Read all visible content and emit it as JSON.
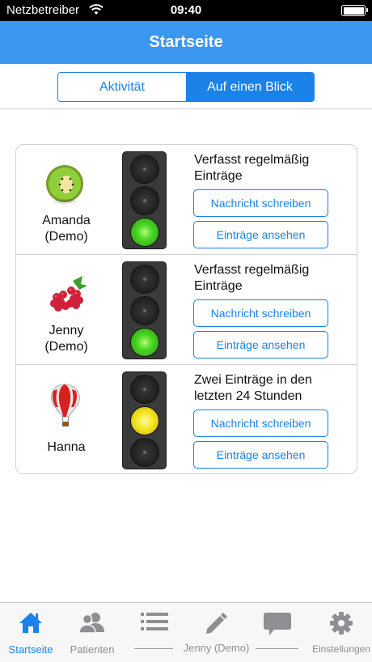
{
  "status_bar": {
    "carrier": "Netzbetreiber",
    "time": "09:40"
  },
  "nav": {
    "title": "Startseite"
  },
  "segments": [
    {
      "label": "Aktivität",
      "active": false
    },
    {
      "label": "Auf einen Blick",
      "active": true
    }
  ],
  "patients": [
    {
      "name_line1": "Amanda",
      "name_line2": "(Demo)",
      "avatar_icon": "kiwi-icon",
      "light": "green",
      "status": "Verfasst regelmäßig Einträge",
      "btn_message": "Nachricht schreiben",
      "btn_entries": "Einträge ansehen"
    },
    {
      "name_line1": "Jenny",
      "name_line2": "(Demo)",
      "avatar_icon": "raspberry-icon",
      "light": "green",
      "status": "Verfasst regelmäßig Einträge",
      "btn_message": "Nachricht schreiben",
      "btn_entries": "Einträge ansehen"
    },
    {
      "name_line1": "Hanna",
      "name_line2": "",
      "avatar_icon": "hot-air-balloon-icon",
      "light": "yellow",
      "status": "Zwei Einträge in den letzten 24 Stunden",
      "btn_message": "Nachricht schreiben",
      "btn_entries": "Einträge ansehen"
    }
  ],
  "tabbar": {
    "startseite": "Startseite",
    "patienten": "Patienten",
    "jenny_group": "Jenny (Demo)",
    "einstellungen": "Einstellungen"
  },
  "colors": {
    "accent": "#1a82e8",
    "navbar": "#3b97f0",
    "green_light": "#4ad426",
    "yellow_light": "#f3e51e"
  }
}
